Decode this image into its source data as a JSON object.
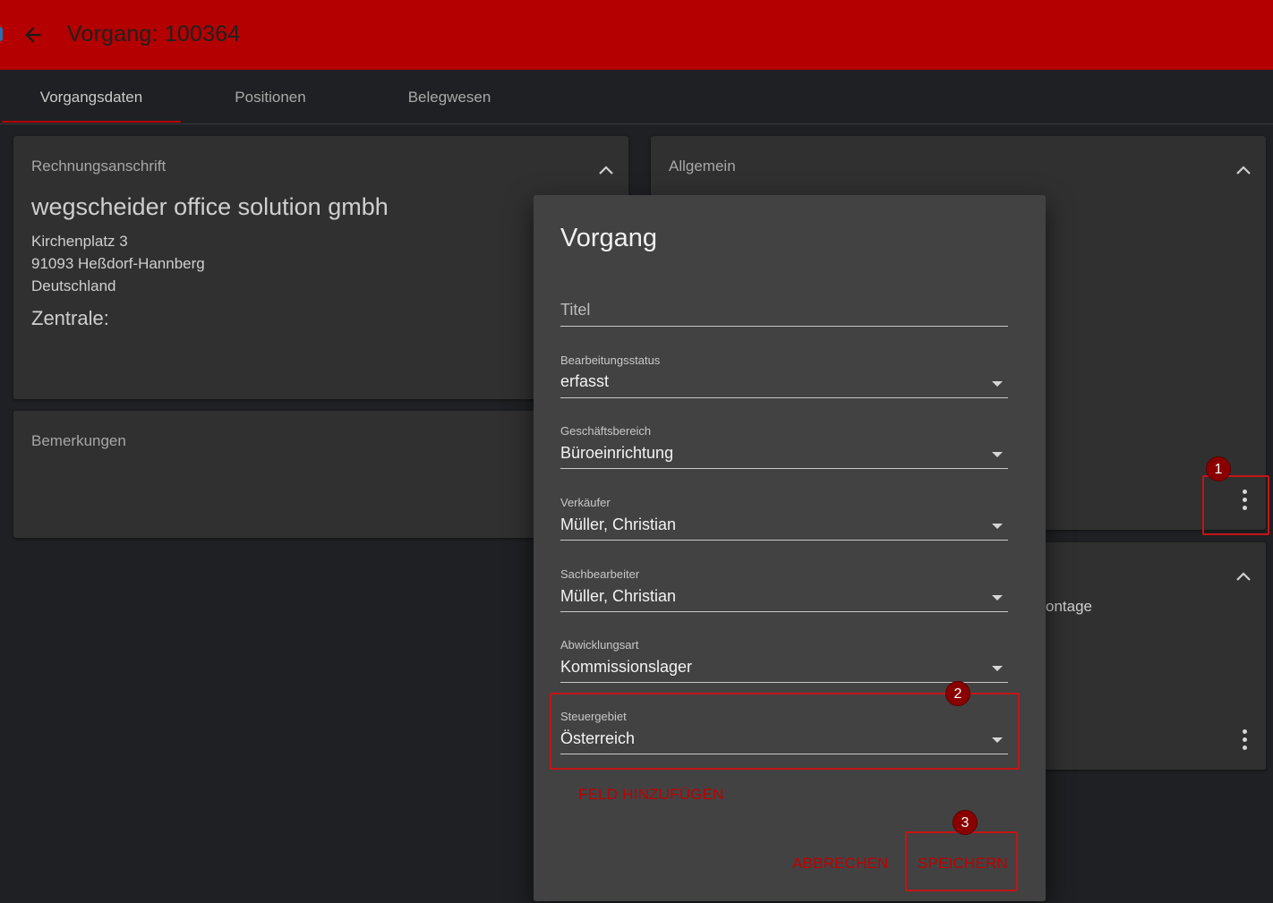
{
  "header": {
    "title": "Vorgang: 100364",
    "back_icon": "arrow-left-icon"
  },
  "tabs": [
    {
      "label": "Vorgangsdaten",
      "active": true
    },
    {
      "label": "Positionen",
      "active": false
    },
    {
      "label": "Belegwesen",
      "active": false
    }
  ],
  "billing_card": {
    "title": "Rechnungsanschrift",
    "company": "wegscheider office solution gmbh",
    "address_lines": [
      "Kirchenplatz 3",
      "91093 Heßdorf-Hannberg",
      "Deutschland"
    ],
    "zentrale_label": "Zentrale:"
  },
  "remarks_card": {
    "title": "Bemerkungen"
  },
  "general_card": {
    "title": "Allgemein"
  },
  "lower_right_card": {
    "partial_text": "ontage"
  },
  "dialog": {
    "title": "Vorgang",
    "title_field_placeholder": "Titel",
    "fields": [
      {
        "label": "Bearbeitungsstatus",
        "value": "erfasst"
      },
      {
        "label": "Geschäftsbereich",
        "value": "Büroeinrichtung"
      },
      {
        "label": "Verkäufer",
        "value": "Müller, Christian"
      },
      {
        "label": "Sachbearbeiter",
        "value": "Müller, Christian"
      },
      {
        "label": "Abwicklungsart",
        "value": "Kommissionslager"
      },
      {
        "label": "Steuergebiet",
        "value": "Österreich"
      }
    ],
    "add_field_label": "FELD HINZUFÜGEN",
    "cancel_label": "ABBRECHEN",
    "save_label": "SPEICHERN"
  },
  "callouts": [
    "1",
    "2",
    "3"
  ],
  "colors": {
    "brand_red": "#b40000",
    "background": "#1f2023",
    "card": "#303030",
    "dialog": "#424242",
    "callout": "#c41515"
  }
}
